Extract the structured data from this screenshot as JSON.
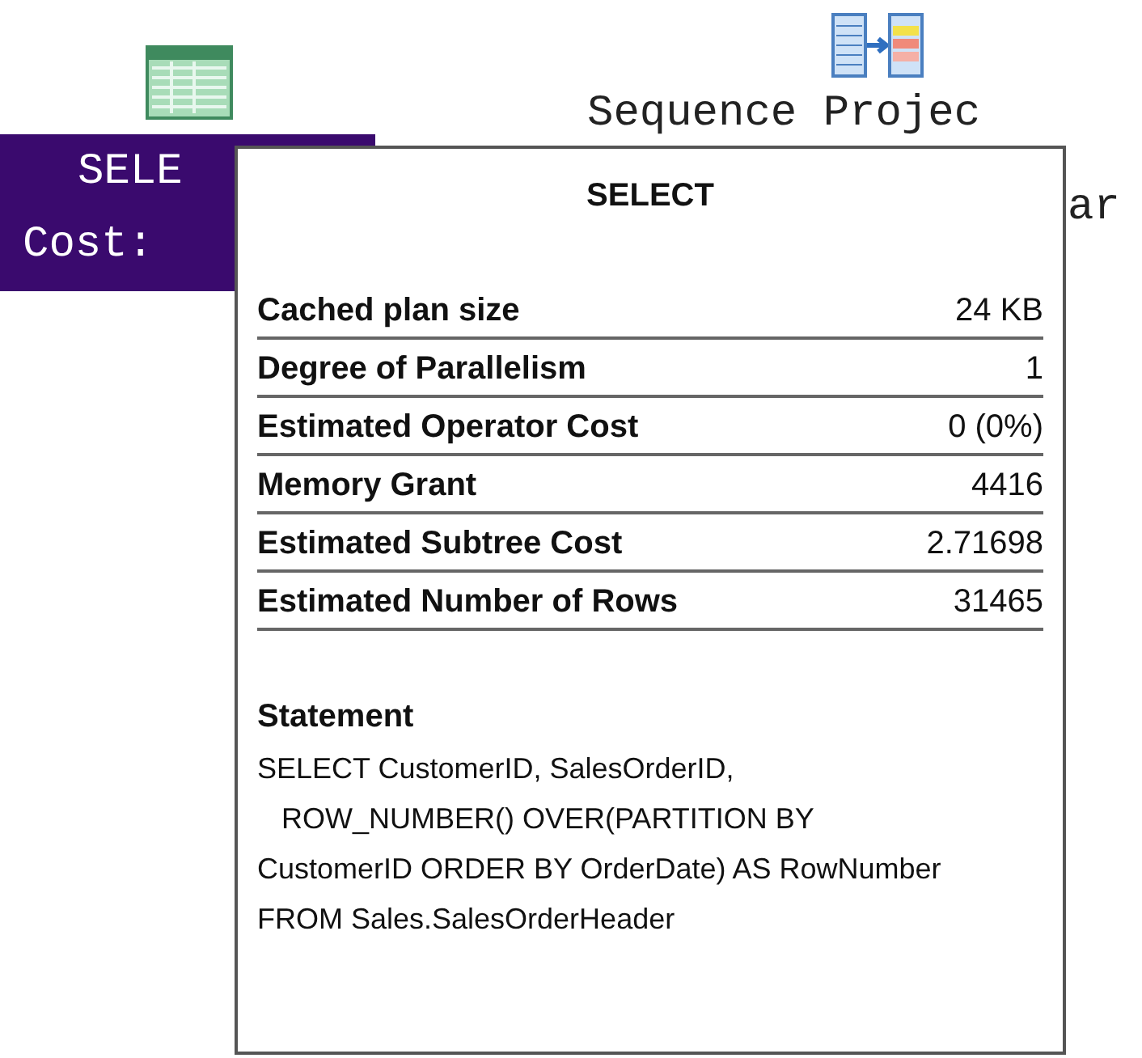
{
  "canvas": {
    "nodes": [
      {
        "kind": "select",
        "lines": [
          "SELE",
          "Cost:"
        ],
        "selected": true
      },
      {
        "kind": "sequence",
        "lines": [
          "Sequence Projec",
          "ar"
        ],
        "selected": false
      }
    ]
  },
  "tooltip": {
    "title": "SELECT",
    "properties": [
      {
        "label": "Cached plan size",
        "value": "24 KB"
      },
      {
        "label": "Degree of Parallelism",
        "value": "1"
      },
      {
        "label": "Estimated Operator Cost",
        "value": "0 (0%)"
      },
      {
        "label": "Memory Grant",
        "value": "4416"
      },
      {
        "label": "Estimated Subtree Cost",
        "value": "2.71698"
      },
      {
        "label": "Estimated Number of Rows",
        "value": "31465"
      }
    ],
    "statement_heading": "Statement",
    "statement": "SELECT CustomerID, SalesOrderID,\n   ROW_NUMBER() OVER(PARTITION BY CustomerID ORDER BY OrderDate) AS RowNumber\nFROM Sales.SalesOrderHeader"
  }
}
